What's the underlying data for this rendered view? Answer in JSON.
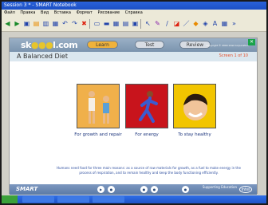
{
  "window": {
    "title": "Session 3 * - SMART Notebook"
  },
  "menu": [
    "Файл",
    "Правка",
    "Вид",
    "Вставка",
    "Формат",
    "Рисование",
    "Справка"
  ],
  "toolbar": {
    "icons": [
      "back-icon",
      "forward-icon",
      "page-icon",
      "open-icon",
      "save-icon",
      "paste-icon",
      "undo-icon",
      "redo-icon",
      "delete-icon",
      "screen-shade-icon",
      "display-icon",
      "table-icon",
      "insert-icon",
      "capture-icon",
      "select-icon",
      "pen-icon",
      "creative-pen-icon",
      "eraser-icon",
      "line-icon",
      "shape-icon",
      "fill-icon",
      "text-icon",
      "properties-icon",
      "more-icon"
    ]
  },
  "lesson": {
    "logo_left": "sk",
    "logo_dots": "●●●",
    "logo_right": "l.com",
    "tabs": {
      "learn": "Learn",
      "test": "Test",
      "review": "Review"
    },
    "copyright": "Copyright © 2004 Intel Corporation",
    "title": "A Balanced Diet",
    "frame_counter": "Screen 1 of 10",
    "captions": [
      "For growth and repair",
      "For energy",
      "To stay healthy"
    ],
    "body": "Humans need food for three main reasons: as a source of raw materials for growth, as a fuel to make energy in the process of respiration, and to remain healthy and keep the body functioning efficiently.",
    "footer_logo": "SMART",
    "supported_by": "Supporting Education",
    "intel": "intel"
  }
}
